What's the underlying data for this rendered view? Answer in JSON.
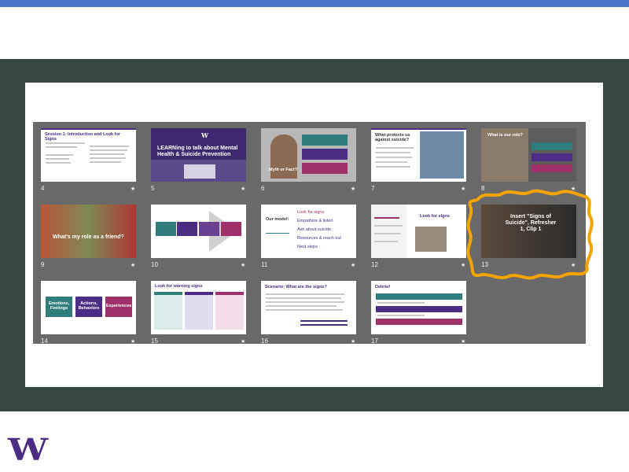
{
  "logo": {
    "letter": "W"
  },
  "slides": [
    {
      "num": "4",
      "title": "Session 1: Introduction and Look for Signs",
      "star": "★"
    },
    {
      "num": "5",
      "title": "LEARNing to talk about Mental Health & Suicide Prevention",
      "star": "★"
    },
    {
      "num": "6",
      "title": "Myth or Fact?",
      "star": "★"
    },
    {
      "num": "7",
      "title": "What protects us against suicide?",
      "star": "★"
    },
    {
      "num": "8",
      "title": "What is our role?",
      "star": "★"
    },
    {
      "num": "9",
      "title": "What's my role as a friend?",
      "star": "★"
    },
    {
      "num": "10",
      "title": "",
      "star": "★"
    },
    {
      "num": "11",
      "title": "Our model:",
      "steps": [
        "Look for signs",
        "Empathize & listen",
        "Ask about suicide",
        "Resources & reach out",
        "Next steps"
      ],
      "star": "★"
    },
    {
      "num": "12",
      "title": "Look for signs",
      "star": "★"
    },
    {
      "num": "13",
      "title": "Insert \"Signs of Suicide\", Refresher 1, Clip 1",
      "star": "★"
    },
    {
      "num": "14",
      "boxes": [
        "Emotions, Feelings",
        "Actions, Behaviors",
        "Experiences"
      ],
      "star": "★"
    },
    {
      "num": "15",
      "title": "Look for warning signs",
      "star": "★"
    },
    {
      "num": "16",
      "title": "Scenario: What are the signs?",
      "star": "★"
    },
    {
      "num": "17",
      "title": "Debrief",
      "star": "★"
    }
  ],
  "colors": {
    "accent_bar": "#4a74c9",
    "band": "#36473f",
    "sorter_bg": "#696969",
    "uw_purple": "#4b2e83",
    "teal": "#2e7d7a",
    "magenta": "#a0306a",
    "annotation": "#f5a300"
  }
}
